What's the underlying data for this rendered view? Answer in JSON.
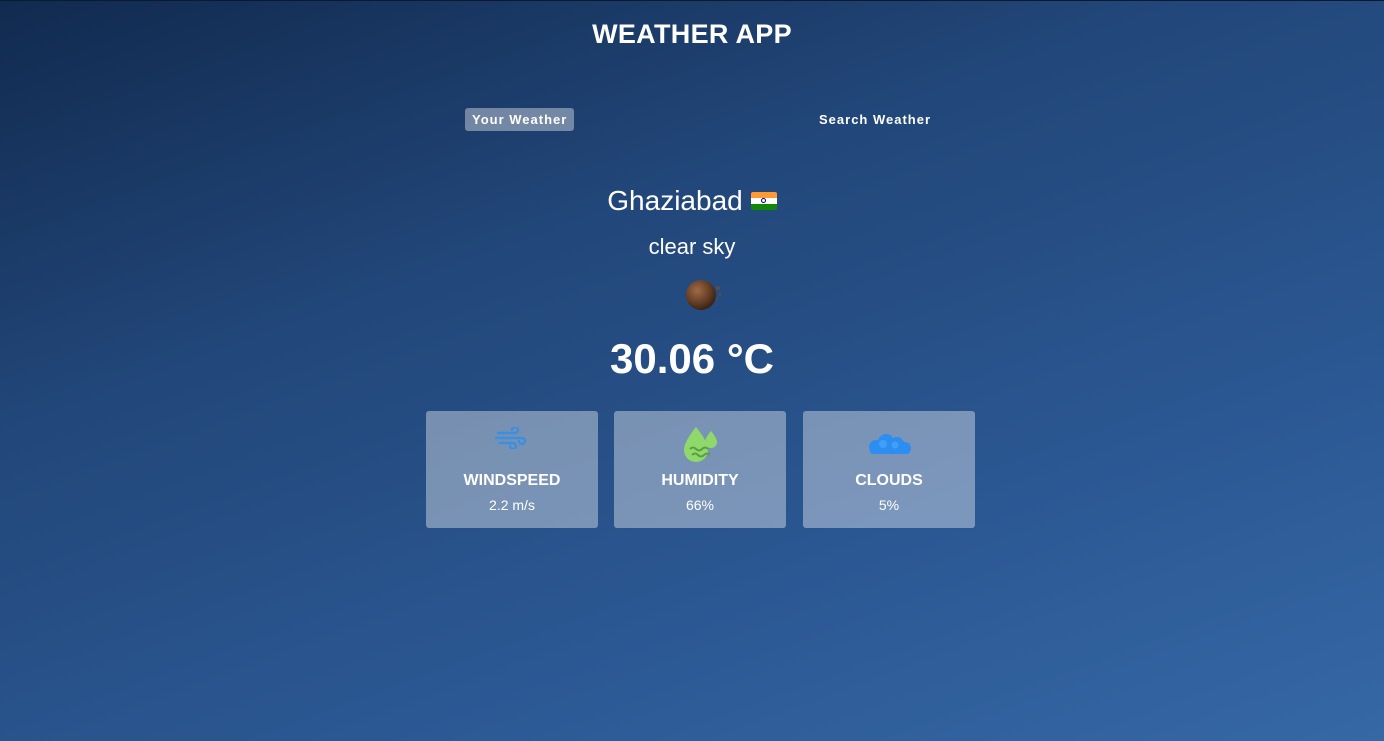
{
  "app": {
    "title": "WEATHER APP"
  },
  "tabs": [
    {
      "label": "Your Weather",
      "active": true
    },
    {
      "label": "Search Weather",
      "active": false
    }
  ],
  "weather": {
    "city": "Ghaziabad",
    "country_flag": "india-flag-icon",
    "description": "clear sky",
    "condition_icon": "clear-sky-night-icon",
    "temperature": "30.06 °C"
  },
  "stats": {
    "windspeed": {
      "label": "WINDSPEED",
      "value": "2.2 m/s",
      "icon": "wind-icon"
    },
    "humidity": {
      "label": "HUMIDITY",
      "value": "66%",
      "icon": "humidity-icon"
    },
    "clouds": {
      "label": "CLOUDS",
      "value": "5%",
      "icon": "cloud-icon"
    }
  },
  "colors": {
    "background_top": "#112a4f",
    "background_bottom": "#3668a6",
    "wind_icon": "#3a8fe0",
    "humidity_icon": "#8fd86a",
    "cloud_icon": "#2b8ef0"
  }
}
